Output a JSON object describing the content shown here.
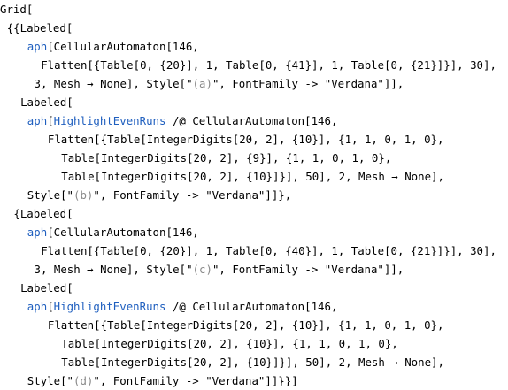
{
  "code": {
    "colors": {
      "function": "#1f5fbf",
      "string_content": "#8a8a8a",
      "plain": "#000000"
    },
    "lines": [
      {
        "indent": 0,
        "tokens": [
          {
            "t": "Grid[",
            "c": "plain"
          }
        ]
      },
      {
        "indent": 1,
        "tokens": [
          {
            "t": "{{Labeled[",
            "c": "plain"
          }
        ]
      },
      {
        "indent": 4,
        "tokens": [
          {
            "t": "aph",
            "c": "blue"
          },
          {
            "t": "[CellularAutomaton[146,",
            "c": "plain"
          }
        ]
      },
      {
        "indent": 6,
        "tokens": [
          {
            "t": "Flatten[{Table[0, {20}], 1, Table[0, {41}], 1, Table[0, {21}]}], 30],",
            "c": "plain"
          }
        ]
      },
      {
        "indent": 5,
        "tokens": [
          {
            "t": "3, Mesh → None], Style[\"",
            "c": "plain"
          },
          {
            "t": "(a)",
            "c": "gray"
          },
          {
            "t": "\", FontFamily -> \"Verdana\"]],",
            "c": "plain"
          }
        ]
      },
      {
        "indent": 3,
        "tokens": [
          {
            "t": "Labeled[",
            "c": "plain"
          }
        ]
      },
      {
        "indent": 4,
        "tokens": [
          {
            "t": "aph",
            "c": "blue"
          },
          {
            "t": "[",
            "c": "plain"
          },
          {
            "t": "HighlightEvenRuns",
            "c": "blue"
          },
          {
            "t": " /@ CellularAutomaton[146,",
            "c": "plain"
          }
        ]
      },
      {
        "indent": 7,
        "tokens": [
          {
            "t": "Flatten[{Table[IntegerDigits[20, 2], {10}], {1, 1, 0, 1, 0},",
            "c": "plain"
          }
        ]
      },
      {
        "indent": 9,
        "tokens": [
          {
            "t": "Table[IntegerDigits[20, 2], {9}], {1, 1, 0, 1, 0},",
            "c": "plain"
          }
        ]
      },
      {
        "indent": 9,
        "tokens": [
          {
            "t": "Table[IntegerDigits[20, 2], {10}]}], 50], 2, Mesh → None],",
            "c": "plain"
          }
        ]
      },
      {
        "indent": 4,
        "tokens": [
          {
            "t": "Style[\"",
            "c": "plain"
          },
          {
            "t": "(b)",
            "c": "gray"
          },
          {
            "t": "\", FontFamily -> \"Verdana\"]]},",
            "c": "plain"
          }
        ]
      },
      {
        "indent": 2,
        "tokens": [
          {
            "t": "{Labeled[",
            "c": "plain"
          }
        ]
      },
      {
        "indent": 4,
        "tokens": [
          {
            "t": "aph",
            "c": "blue"
          },
          {
            "t": "[CellularAutomaton[146,",
            "c": "plain"
          }
        ]
      },
      {
        "indent": 6,
        "tokens": [
          {
            "t": "Flatten[{Table[0, {20}], 1, Table[0, {40}], 1, Table[0, {21}]}], 30],",
            "c": "plain"
          }
        ]
      },
      {
        "indent": 5,
        "tokens": [
          {
            "t": "3, Mesh → None], Style[\"",
            "c": "plain"
          },
          {
            "t": "(c)",
            "c": "gray"
          },
          {
            "t": "\", FontFamily -> \"Verdana\"]],",
            "c": "plain"
          }
        ]
      },
      {
        "indent": 3,
        "tokens": [
          {
            "t": "Labeled[",
            "c": "plain"
          }
        ]
      },
      {
        "indent": 4,
        "tokens": [
          {
            "t": "aph",
            "c": "blue"
          },
          {
            "t": "[",
            "c": "plain"
          },
          {
            "t": "HighlightEvenRuns",
            "c": "blue"
          },
          {
            "t": " /@ CellularAutomaton[146,",
            "c": "plain"
          }
        ]
      },
      {
        "indent": 7,
        "tokens": [
          {
            "t": "Flatten[{Table[IntegerDigits[20, 2], {10}], {1, 1, 0, 1, 0},",
            "c": "plain"
          }
        ]
      },
      {
        "indent": 9,
        "tokens": [
          {
            "t": "Table[IntegerDigits[20, 2], {10}], {1, 1, 0, 1, 0},",
            "c": "plain"
          }
        ]
      },
      {
        "indent": 9,
        "tokens": [
          {
            "t": "Table[IntegerDigits[20, 2], {10}]}], 50], 2, Mesh → None],",
            "c": "plain"
          }
        ]
      },
      {
        "indent": 4,
        "tokens": [
          {
            "t": "Style[\"",
            "c": "plain"
          },
          {
            "t": "(d)",
            "c": "gray"
          },
          {
            "t": "\", FontFamily -> \"Verdana\"]]}}]",
            "c": "plain"
          }
        ]
      }
    ]
  }
}
